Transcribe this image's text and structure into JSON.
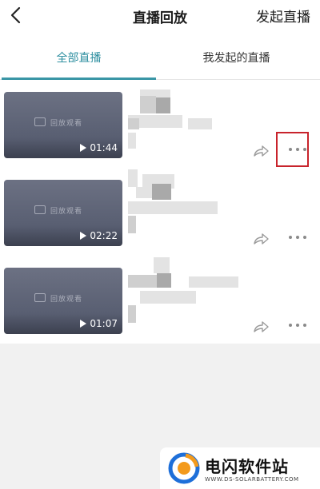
{
  "header": {
    "title": "直播回放",
    "action_label": "发起直播",
    "back_icon": "chevron-left-icon"
  },
  "tabs": [
    {
      "label": "全部直播",
      "active": true
    },
    {
      "label": "我发起的直播",
      "active": false
    }
  ],
  "colors": {
    "accent": "#3a96a6",
    "highlight": "#c8232c",
    "thumbnail": "#5e6477"
  },
  "videos": [
    {
      "thumb_text": "回放观看",
      "duration": "01:44"
    },
    {
      "thumb_text": "回放观看",
      "duration": "02:22"
    },
    {
      "thumb_text": "回放观看",
      "duration": "01:07"
    }
  ],
  "watermark": {
    "title": "电闪软件站",
    "url": "WWW.DS-SOLARBATTERY.COM"
  }
}
